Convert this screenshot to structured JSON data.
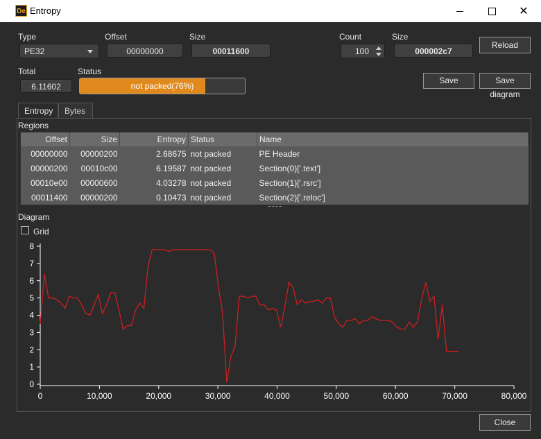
{
  "window": {
    "title": "Entropy",
    "app_icon_text": "De"
  },
  "header": {
    "type_label": "Type",
    "type_value": "PE32",
    "offset_label": "Offset",
    "offset_value": "00000000",
    "size_label": "Size",
    "size_value": "00011600",
    "count_label": "Count",
    "count_value": "100",
    "size2_label": "Size",
    "size2_value": "000002c7",
    "reload_label": "Reload",
    "total_label": "Total",
    "total_value": "6.11602",
    "status_label": "Status",
    "status_text": "not packed(76%)",
    "status_progress": 0.76,
    "save_label": "Save",
    "save_diagram_label": "Save diagram"
  },
  "tabs": [
    {
      "label": "Entropy"
    },
    {
      "label": "Bytes"
    }
  ],
  "regions": {
    "label": "Regions",
    "columns": [
      "Offset",
      "Size",
      "Entropy",
      "Status",
      "Name"
    ],
    "rows": [
      [
        "00000000",
        "00000200",
        "2.68675",
        "not packed",
        "PE Header"
      ],
      [
        "00000200",
        "00010c00",
        "6.19587",
        "not packed",
        "Section(0)['.text']"
      ],
      [
        "00010e00",
        "00000600",
        "4.03278",
        "not packed",
        "Section(1)['.rsrc']"
      ],
      [
        "00011400",
        "00000200",
        "0.10473",
        "not packed",
        "Section(2)['.reloc']"
      ]
    ]
  },
  "diagram": {
    "label": "Diagram",
    "grid_label": "Grid"
  },
  "close_label": "Close",
  "colors": {
    "accent": "#e08a1e",
    "line": "#cc1f1f"
  },
  "chart_data": {
    "type": "line",
    "grid": false,
    "xlim": [
      0,
      80000
    ],
    "ylim": [
      0,
      8
    ],
    "xticks": [
      "0",
      "10,000",
      "20,000",
      "30,000",
      "40,000",
      "50,000",
      "60,000",
      "70,000",
      "80,000"
    ],
    "yticks": [
      "0",
      "1",
      "2",
      "3",
      "4",
      "5",
      "6",
      "7",
      "8"
    ],
    "series": [
      {
        "x": [
          0,
          700,
          1400,
          2100,
          2800,
          3500,
          4200,
          4900,
          5600,
          6300,
          7000,
          7700,
          8400,
          9100,
          9800,
          10500,
          11200,
          11900,
          12600,
          13300,
          14000,
          14700,
          15400,
          16100,
          16800,
          17500,
          18200,
          18900,
          19600,
          20300,
          21000,
          21700,
          22400,
          23100,
          23800,
          24500,
          25200,
          25900,
          26600,
          27300,
          28000,
          28700,
          29400,
          30100,
          30800,
          31500,
          32200,
          32900,
          33600,
          34300,
          35000,
          35700,
          36400,
          37100,
          37800,
          38500,
          39200,
          39900,
          40600,
          41300,
          42000,
          42700,
          43400,
          44100,
          44800,
          45500,
          46200,
          46900,
          47600,
          48300,
          49000,
          49700,
          50400,
          51100,
          51800,
          52500,
          53200,
          53900,
          54600,
          55300,
          56000,
          56700,
          57400,
          58100,
          58800,
          59500,
          60200,
          60900,
          61600,
          62300,
          63000,
          63700,
          64400,
          65100,
          65800,
          66500,
          67200,
          67900,
          68600,
          69300,
          70000,
          70700
        ],
        "y": [
          3.5,
          6.4,
          5.0,
          5.0,
          4.9,
          4.7,
          4.4,
          5.1,
          5.0,
          5.0,
          4.6,
          4.1,
          4.0,
          4.6,
          5.2,
          4.1,
          4.6,
          5.3,
          5.3,
          4.3,
          3.2,
          3.4,
          3.4,
          4.3,
          4.7,
          4.4,
          6.8,
          7.8,
          7.8,
          7.8,
          7.8,
          7.7,
          7.8,
          7.8,
          7.8,
          7.8,
          7.8,
          7.8,
          7.8,
          7.8,
          7.8,
          7.8,
          7.6,
          5.6,
          4.1,
          0.1,
          1.6,
          2.2,
          5.1,
          5.1,
          5.0,
          5.1,
          5.1,
          4.6,
          4.6,
          4.3,
          4.4,
          4.3,
          3.3,
          4.5,
          5.9,
          5.6,
          4.6,
          4.9,
          4.7,
          4.8,
          4.8,
          4.9,
          4.7,
          5.0,
          5.0,
          3.9,
          3.5,
          3.3,
          3.7,
          3.7,
          3.8,
          3.5,
          3.7,
          3.7,
          3.9,
          3.8,
          3.7,
          3.7,
          3.7,
          3.6,
          3.3,
          3.2,
          3.2,
          3.6,
          3.3,
          3.6,
          4.9,
          5.9,
          4.8,
          5.1,
          2.6,
          4.6,
          1.9,
          1.9,
          1.9,
          1.9
        ]
      }
    ]
  }
}
